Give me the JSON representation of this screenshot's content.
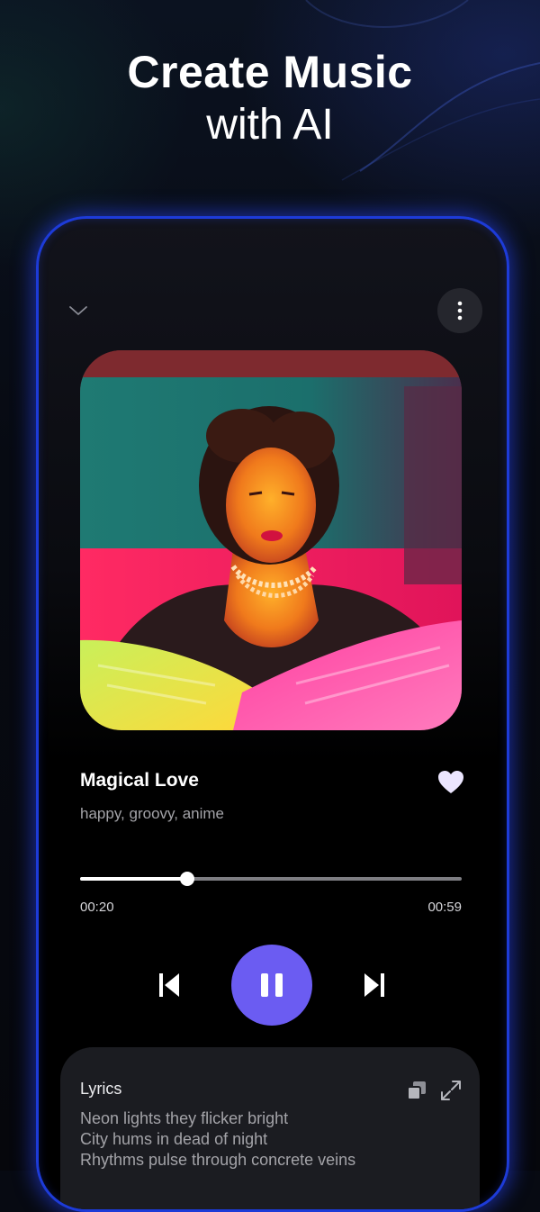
{
  "promo": {
    "headline_line1": "Create Music",
    "headline_line2": "with AI"
  },
  "player": {
    "track": {
      "title": "Magical Love",
      "tags": "happy, groovy, anime",
      "liked": true
    },
    "progress": {
      "current": "00:20",
      "total": "00:59",
      "fraction": 0.28
    },
    "controls": {
      "state": "playing",
      "play_button_color": "#6b5cf2"
    },
    "lyrics": {
      "label": "Lyrics",
      "lines": [
        "Neon lights they flicker bright",
        "City hums in dead of night",
        "Rhythms pulse through concrete veins"
      ]
    }
  },
  "icons": {
    "collapse": "chevron-down-icon",
    "menu": "more-vertical-icon",
    "like": "heart-icon",
    "prev": "skip-previous-icon",
    "play_pause": "pause-icon",
    "next": "skip-next-icon",
    "copy": "copy-icon",
    "expand": "expand-icon"
  },
  "colors": {
    "accent": "#6b5cf2",
    "phone_border": "#1d3bd8",
    "heart": "#ece6ff"
  }
}
